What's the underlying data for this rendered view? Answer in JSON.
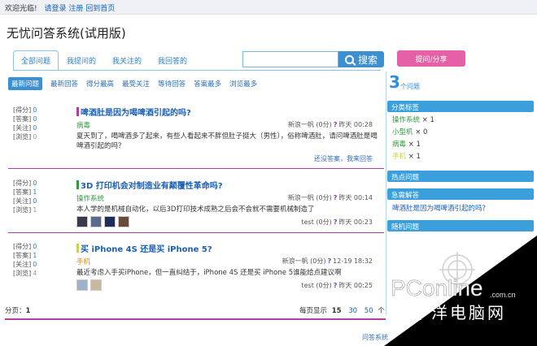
{
  "topbar": {
    "greet": "欢迎光临!",
    "login": "请登录",
    "register": "注册",
    "home": "回到首页"
  },
  "site_title": "无忧问答系统(试用版)",
  "tabs": [
    "全部问题",
    "我提问的",
    "我关注的",
    "我回答的"
  ],
  "search": {
    "button": "搜索",
    "placeholder": ""
  },
  "ask_button": "提问/分享",
  "subnav": [
    "最新问题",
    "最新回答",
    "得分最高",
    "最受关注",
    "等待回答",
    "答案最多",
    "浏览最多"
  ],
  "stat_labels": [
    "[得分]",
    "[答案]",
    "[关注]",
    "[浏览]"
  ],
  "questions": [
    {
      "title": "啤酒肚是因为喝啤酒引起的吗?",
      "bar_color": "#b13fa2",
      "stats": [
        "0",
        "0",
        "0",
        "0"
      ],
      "category": "病毒",
      "cat_color": "#2e9c3a",
      "author": "新浪一帆",
      "points": "(0分)",
      "time": "昨天 00:28",
      "desc": "夏天到了，喝啤酒多了起来，有些人看起来不胖但肚子挺大（男性），俗称啤酒肚，请问啤酒肚是喝啤酒引起的吗？",
      "footer": "还没答案，我来回答"
    },
    {
      "title": "3D 打印机会对制造业有颠覆性革命吗?",
      "bar_color": "#2e9c3a",
      "stats": [
        "0",
        "1",
        "0",
        "1"
      ],
      "category": "操作系统",
      "cat_color": "#2e9c3a",
      "author": "新浪一帆",
      "points": "(0分)",
      "time": "昨天 00:14",
      "desc": "本人学的是机械自动化，以后3D打印技术成熟之后会不会就不需要机械制造了",
      "footer_author": "test",
      "footer_points": "(0分)",
      "footer_time": "昨天 00:23"
    },
    {
      "title": "买 iPhone 4S 还是买 iPhone 5?",
      "bar_color": "#c9d64a",
      "stats": [
        "0",
        "1",
        "0",
        "4"
      ],
      "category": "手机",
      "cat_color": "#e08a1e",
      "author": "新浪一帆",
      "points": "(0分)",
      "time": "12-19 18:32",
      "desc": "最近考虑入手买iPhone，但一直纠结于，iPhone 4S 还是买 iPhone 5谁能给点建议啊",
      "footer_author": "test",
      "footer_points": "(0分)",
      "footer_time": "昨天 00:25"
    }
  ],
  "pager": {
    "label": "分页：",
    "page": "1"
  },
  "per_page": {
    "label": "每页显示",
    "options": [
      "15",
      "30",
      "50"
    ],
    "unit": "个"
  },
  "bottom_link": "问答系统",
  "sidebar": {
    "count": "3",
    "count_label": "个问题",
    "tags_header": "分类标签",
    "tags": [
      {
        "name": "操作系统",
        "count": "× 1",
        "color": "#2e9c3a"
      },
      {
        "name": "小型机",
        "count": "× 0",
        "color": "#2e9c3a"
      },
      {
        "name": "病毒",
        "count": "× 1",
        "color": "#2e9c3a"
      },
      {
        "name": "手机",
        "count": "× 1",
        "color": "#c9d64a"
      }
    ],
    "hot_header": "热点问题",
    "urgent_header": "急需解答",
    "urgent_item": "啤酒肚是因为喝啤酒引起的吗?",
    "random_header": "随机问题"
  },
  "watermark": {
    "brand": "PConline",
    "domain": ".com.cn",
    "cn": "太平洋电脑网"
  },
  "colors": {
    "accent": "#3b8fd3",
    "pink": "#e660a8",
    "magenta": "#b13fa2"
  }
}
